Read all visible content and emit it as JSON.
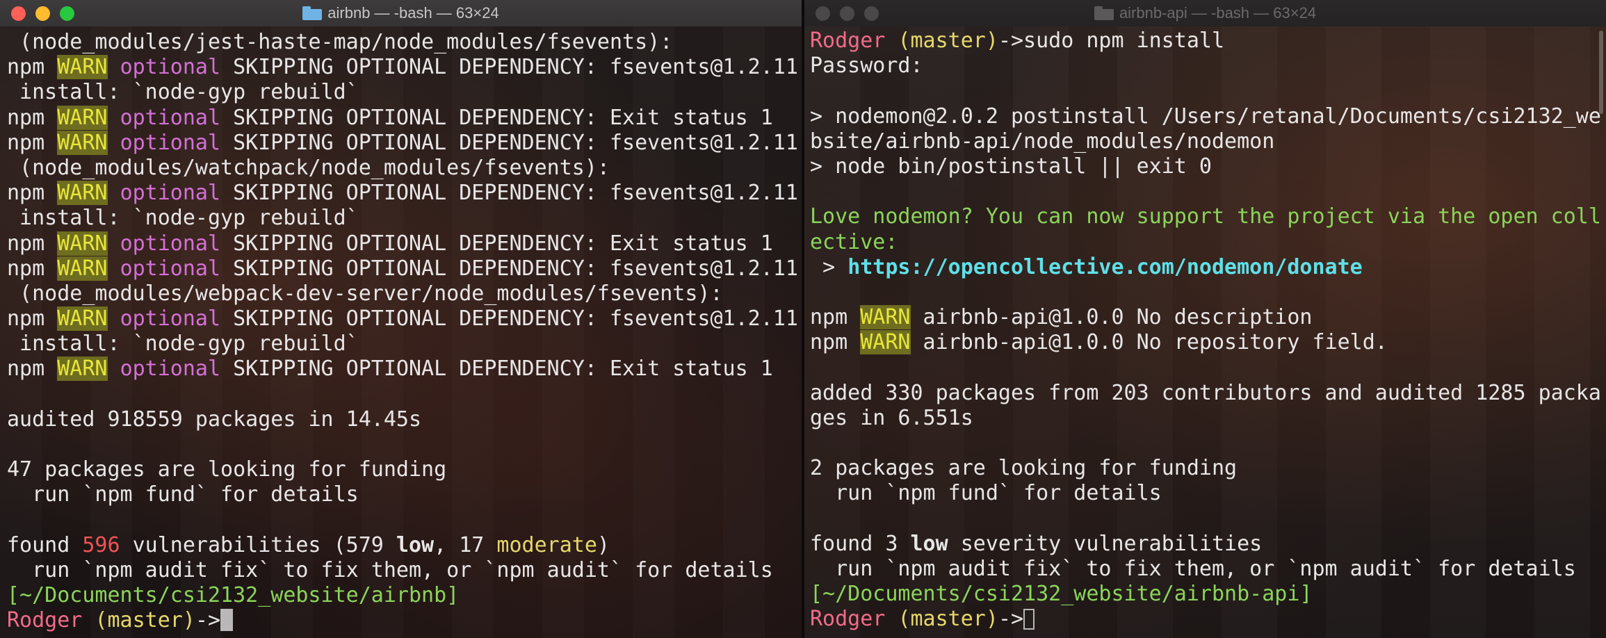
{
  "left_window": {
    "title": "airbnb — -bash — 63×24",
    "lines": [
      [
        {
          "t": " (node_modules/jest-haste-map/node_modules/fsevents):"
        }
      ],
      [
        {
          "t": "npm "
        },
        {
          "t": "WARN",
          "c": "warn"
        },
        {
          "t": " "
        },
        {
          "t": "optional",
          "c": "optional"
        },
        {
          "t": " SKIPPING OPTIONAL DEPENDENCY: fsevents@1.2.11"
        }
      ],
      [
        {
          "t": " install: `node-gyp rebuild`"
        }
      ],
      [
        {
          "t": "npm "
        },
        {
          "t": "WARN",
          "c": "warn"
        },
        {
          "t": " "
        },
        {
          "t": "optional",
          "c": "optional"
        },
        {
          "t": " SKIPPING OPTIONAL DEPENDENCY: Exit status 1"
        }
      ],
      [
        {
          "t": "npm "
        },
        {
          "t": "WARN",
          "c": "warn"
        },
        {
          "t": " "
        },
        {
          "t": "optional",
          "c": "optional"
        },
        {
          "t": " SKIPPING OPTIONAL DEPENDENCY: fsevents@1.2.11"
        }
      ],
      [
        {
          "t": " (node_modules/watchpack/node_modules/fsevents):"
        }
      ],
      [
        {
          "t": "npm "
        },
        {
          "t": "WARN",
          "c": "warn"
        },
        {
          "t": " "
        },
        {
          "t": "optional",
          "c": "optional"
        },
        {
          "t": " SKIPPING OPTIONAL DEPENDENCY: fsevents@1.2.11"
        }
      ],
      [
        {
          "t": " install: `node-gyp rebuild`"
        }
      ],
      [
        {
          "t": "npm "
        },
        {
          "t": "WARN",
          "c": "warn"
        },
        {
          "t": " "
        },
        {
          "t": "optional",
          "c": "optional"
        },
        {
          "t": " SKIPPING OPTIONAL DEPENDENCY: Exit status 1"
        }
      ],
      [
        {
          "t": "npm "
        },
        {
          "t": "WARN",
          "c": "warn"
        },
        {
          "t": " "
        },
        {
          "t": "optional",
          "c": "optional"
        },
        {
          "t": " SKIPPING OPTIONAL DEPENDENCY: fsevents@1.2.11"
        }
      ],
      [
        {
          "t": " (node_modules/webpack-dev-server/node_modules/fsevents):"
        }
      ],
      [
        {
          "t": "npm "
        },
        {
          "t": "WARN",
          "c": "warn"
        },
        {
          "t": " "
        },
        {
          "t": "optional",
          "c": "optional"
        },
        {
          "t": " SKIPPING OPTIONAL DEPENDENCY: fsevents@1.2.11"
        }
      ],
      [
        {
          "t": " install: `node-gyp rebuild`"
        }
      ],
      [
        {
          "t": "npm "
        },
        {
          "t": "WARN",
          "c": "warn"
        },
        {
          "t": " "
        },
        {
          "t": "optional",
          "c": "optional"
        },
        {
          "t": " SKIPPING OPTIONAL DEPENDENCY: Exit status 1"
        }
      ],
      [
        {
          "t": ""
        }
      ],
      [
        {
          "t": "audited 918559 packages in 14.45s"
        }
      ],
      [
        {
          "t": ""
        }
      ],
      [
        {
          "t": "47 packages are looking for funding"
        }
      ],
      [
        {
          "t": "  run `npm fund` for details"
        }
      ],
      [
        {
          "t": ""
        }
      ],
      [
        {
          "t": "found "
        },
        {
          "t": "596",
          "c": "red"
        },
        {
          "t": " vulnerabilities (579 "
        },
        {
          "t": "low",
          "c": "bold"
        },
        {
          "t": ", 17 "
        },
        {
          "t": "moderate",
          "c": "yellow"
        },
        {
          "t": ")"
        }
      ],
      [
        {
          "t": "  run `npm audit fix` to fix them, or `npm audit` for details"
        }
      ],
      [
        {
          "t": "[~/Documents/csi2132_website/airbnb]",
          "c": "green"
        }
      ],
      [
        {
          "t": "Rodger",
          "c": "pink"
        },
        {
          "t": " "
        },
        {
          "t": "(master)",
          "c": "yellow"
        },
        {
          "t": "->"
        },
        {
          "cursor": "block"
        }
      ]
    ]
  },
  "right_window": {
    "title": "airbnb-api — -bash — 63×24",
    "lines": [
      [
        {
          "t": "Rodger",
          "c": "pink"
        },
        {
          "t": " "
        },
        {
          "t": "(master)",
          "c": "yellow"
        },
        {
          "t": "->sudo npm install"
        }
      ],
      [
        {
          "t": "Password:"
        }
      ],
      [
        {
          "t": ""
        }
      ],
      [
        {
          "t": "> nodemon@2.0.2 postinstall /Users/retanal/Documents/csi2132_we"
        }
      ],
      [
        {
          "t": "bsite/airbnb-api/node_modules/nodemon"
        }
      ],
      [
        {
          "t": "> node bin/postinstall || exit 0"
        }
      ],
      [
        {
          "t": ""
        }
      ],
      [
        {
          "t": "Love nodemon? You can now support the project via the open coll",
          "c": "green"
        }
      ],
      [
        {
          "t": "ective:",
          "c": "green"
        }
      ],
      [
        {
          "t": " > "
        },
        {
          "t": "https://opencollective.com/nodemon/donate",
          "c": "cyan"
        }
      ],
      [
        {
          "t": ""
        }
      ],
      [
        {
          "t": "npm "
        },
        {
          "t": "WARN",
          "c": "warn"
        },
        {
          "t": " airbnb-api@1.0.0 No description"
        }
      ],
      [
        {
          "t": "npm "
        },
        {
          "t": "WARN",
          "c": "warn"
        },
        {
          "t": " airbnb-api@1.0.0 No repository field."
        }
      ],
      [
        {
          "t": ""
        }
      ],
      [
        {
          "t": "added 330 packages from 203 contributors and audited 1285 packa"
        }
      ],
      [
        {
          "t": "ges in 6.551s"
        }
      ],
      [
        {
          "t": ""
        }
      ],
      [
        {
          "t": "2 packages are looking for funding"
        }
      ],
      [
        {
          "t": "  run `npm fund` for details"
        }
      ],
      [
        {
          "t": ""
        }
      ],
      [
        {
          "t": "found 3 "
        },
        {
          "t": "low",
          "c": "bold"
        },
        {
          "t": " severity vulnerabilities"
        }
      ],
      [
        {
          "t": "  run `npm audit fix` to fix them, or `npm audit` for details"
        }
      ],
      [
        {
          "t": "[~/Documents/csi2132_website/airbnb-api]",
          "c": "green"
        }
      ],
      [
        {
          "t": "Rodger",
          "c": "pink"
        },
        {
          "t": " "
        },
        {
          "t": "(master)",
          "c": "yellow"
        },
        {
          "t": "->"
        },
        {
          "cursor": "outline"
        }
      ]
    ]
  }
}
